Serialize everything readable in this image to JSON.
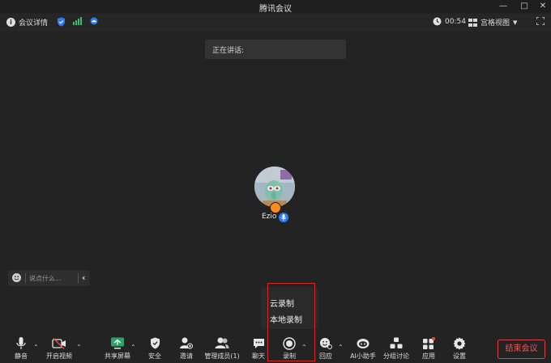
{
  "window": {
    "title": "腾讯会议"
  },
  "infobar": {
    "meeting_details": "会议详情",
    "timer": "00:54",
    "view_mode": "宫格视图"
  },
  "speaking": {
    "label": "正在讲话:"
  },
  "participant": {
    "name": "Ezio"
  },
  "chat": {
    "placeholder": "说点什么..."
  },
  "record_menu": {
    "items": [
      {
        "label": "云录制"
      },
      {
        "label": "本地录制"
      }
    ]
  },
  "toolbar": {
    "mute": "静音",
    "video": "开启视频",
    "share": "共享屏幕",
    "security": "安全",
    "invite": "邀请",
    "members": "管理成员(1)",
    "chat": "聊天",
    "record": "录制",
    "reaction": "回应",
    "ai": "AI小助手",
    "breakout": "分组讨论",
    "apps": "应用",
    "settings": "设置",
    "end": "结束会议"
  },
  "colors": {
    "accent_blue": "#2f7bf5",
    "signal_green": "#2fc26b",
    "end_red": "#ef5555",
    "share_green": "#2aa36b",
    "highlight_box": "#d42a2a"
  }
}
